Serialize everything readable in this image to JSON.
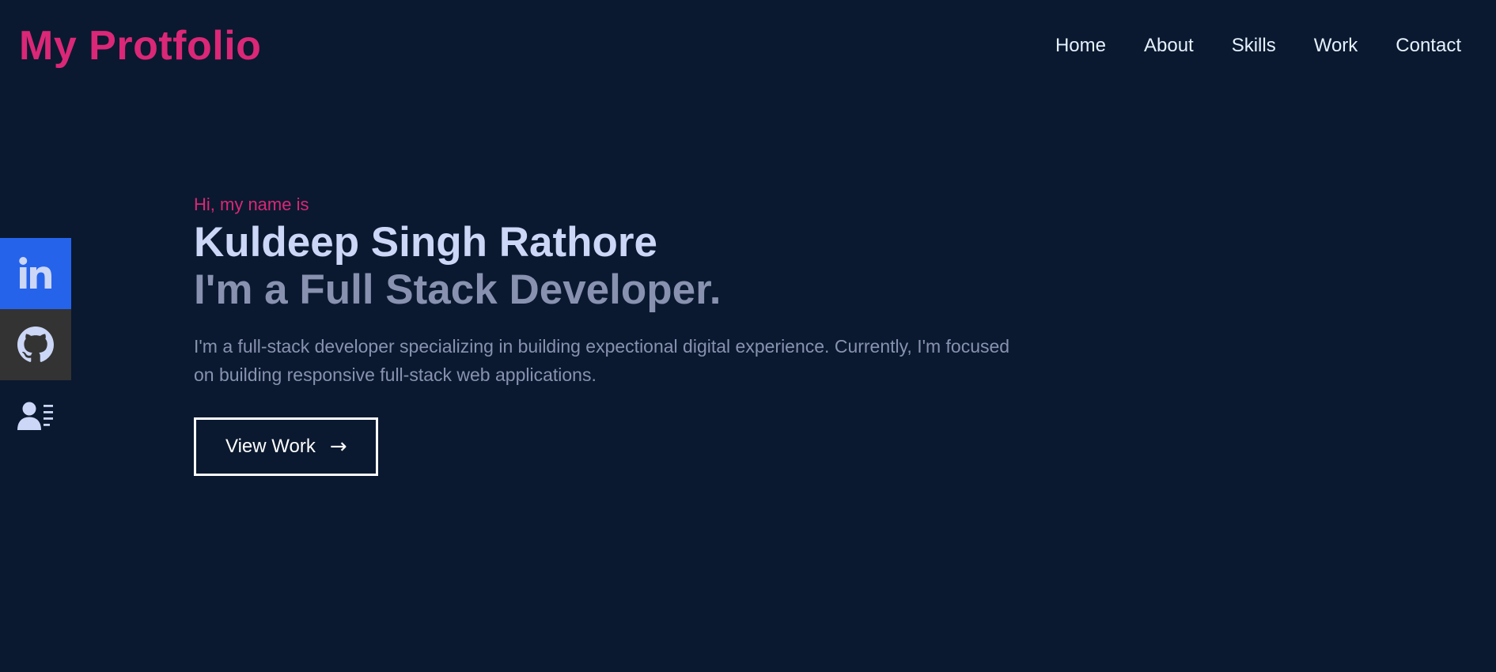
{
  "header": {
    "logo": "My Protfolio",
    "nav": [
      {
        "label": "Home"
      },
      {
        "label": "About"
      },
      {
        "label": "Skills"
      },
      {
        "label": "Work"
      },
      {
        "label": "Contact"
      }
    ]
  },
  "social": {
    "items": [
      {
        "icon": "linkedin-icon",
        "color": "#2563eb"
      },
      {
        "icon": "github-icon",
        "color": "#333333"
      },
      {
        "icon": "resume-icon",
        "color": "#0a192f"
      }
    ]
  },
  "hero": {
    "greeting": "Hi, my name is",
    "name": "Kuldeep Singh Rathore",
    "role": "I'm a Full Stack Developer.",
    "description": "I'm a full-stack developer specializing in building expectional digital experience. Currently, I'm focused on building responsive full-stack web applications.",
    "button_label": "View Work",
    "button_arrow": "→"
  },
  "colors": {
    "background": "#0a192f",
    "accent": "#db2777",
    "heading": "#ccd6f6",
    "muted": "#8892b0",
    "nav_text": "#e6f1ff"
  }
}
